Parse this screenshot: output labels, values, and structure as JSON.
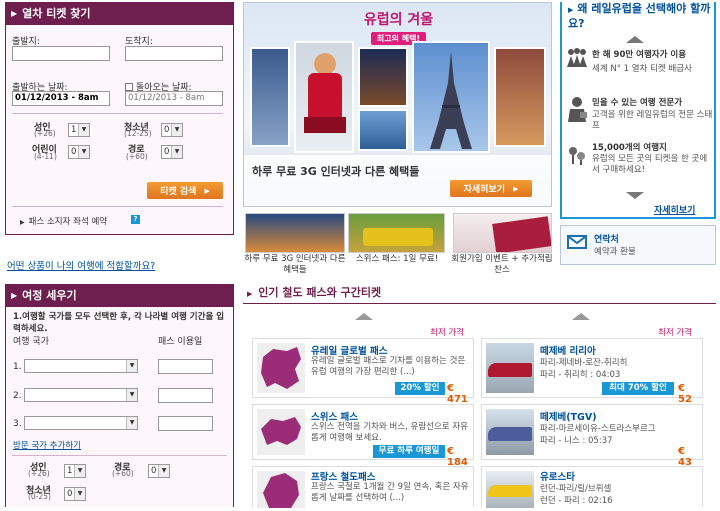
{
  "colors": {
    "accent": "#6e1f4f",
    "link": "#00529c",
    "orange": "#e0751d",
    "blue": "#1a97d5"
  },
  "train_search": {
    "title": "열차 티켓 찾기",
    "from_label": "출발지:",
    "to_label": "도착지:",
    "depart_label": "출발하는 날짜:",
    "return_label": "돌아오는 날짜:",
    "depart_value": "01/12/2013 - 8am",
    "return_value": "01/12/2013 - 8am",
    "adult_label": "성인",
    "adult_age": "(+26)",
    "adult_value": "1",
    "youth_label": "청소년",
    "youth_age": "(12-25)",
    "youth_value": "0",
    "child_label": "어린이",
    "child_age": "(4-11)",
    "child_value": "0",
    "senior_label": "경로",
    "senior_age": "(+60)",
    "senior_value": "0",
    "search_button": "티켓 검색",
    "pass_holder": "패스 소지자 좌석 예약",
    "help": "?"
  },
  "fit_link": "어떤 상품이 나의 여행에 적합할까요?",
  "trip_plan": {
    "title": "여정 세우기",
    "desc": "1.여행할 국가를 모두 선택한 후, 각 나라별 여행 기간을 입력하세요.",
    "country_label": "여행 국가",
    "days_label": "패스 이용일",
    "rows": [
      "1.",
      "2.",
      "3."
    ],
    "add_link": "방문 국가 추가하기",
    "adult_label": "성인",
    "adult_age": "(+26)",
    "adult_value": "1",
    "senior_label": "경로",
    "senior_age": "(+60)",
    "senior_value": "0",
    "youth_label": "청소년",
    "youth_age": "(0-25)",
    "youth_value": "0"
  },
  "hero": {
    "title": "유럽의 겨울",
    "subtitle": "최고의 혜택!",
    "caption": "하루 무료 3G 인터넷과 다른 혜택들",
    "button": "자세히보기"
  },
  "thumbs": [
    {
      "caption": "하루 무료 3G 인터넷과 다른 혜택들"
    },
    {
      "caption": "스위스 패스: 1일 무료!"
    },
    {
      "caption": "회원가입 이벤트 + 추가적립 찬스"
    }
  ],
  "why": {
    "title": "왜 레일유럽을 선택해야 할까요?",
    "items": [
      {
        "head": "한 해 90만 여행자가 이용",
        "body": "세계 N° 1 열차 티켓 배급사"
      },
      {
        "head": "믿을 수 있는 여행 전문가",
        "body": "고객을 위한 레일유럽의 전문 스태프"
      },
      {
        "head": "15,000개의 여행지",
        "body": "유럽의 모든 곳의 티켓을 한 곳에서 구매하세요!"
      }
    ],
    "more": "자세히보기"
  },
  "contact": {
    "title": "연락처",
    "body": "예약과 환불"
  },
  "popular": {
    "title": "인기 철도 패스와 구간티켓",
    "price_label": "최저 가격",
    "left": [
      {
        "title": "유레일 글로벌 패스",
        "desc": "유레일 글로벌 패스로 기차를 이용하는 것은 유럽 여행의 가장 편리한 (...)",
        "badge": "20% 할인",
        "price": "€ 471"
      },
      {
        "title": "스위스 패스",
        "desc": "스위스 전역을 기차와 버스, 유람선으로 자유롭게 여행해 보세요.",
        "badge": "무료 하루 여행일",
        "price": "€ 184"
      },
      {
        "title": "프랑스 철도패스",
        "desc": "프랑스 국철로 1개월 간 9일 연속, 혹은 자유롭게 날짜를 선택하여 (...)",
        "badge": "",
        "price": ""
      }
    ],
    "right": [
      {
        "title": "떼제베 리리아",
        "desc1": "파리-제네바-로잔-취리히",
        "desc2": "파리 - 취리히 : 04:03",
        "badge": "최대 70% 할인",
        "price": "€ 52"
      },
      {
        "title": "떼제베(TGV)",
        "desc1": "파리-마르세이유-스트라스부르그",
        "desc2": "파리 - 니스 : 05:37",
        "badge": "",
        "price": "€ 43"
      },
      {
        "title": "유로스타",
        "desc1": "런던-파리/릴/브뤼셀",
        "desc2": "런던 - 파리 : 02:16",
        "badge": "",
        "price": ""
      }
    ]
  }
}
